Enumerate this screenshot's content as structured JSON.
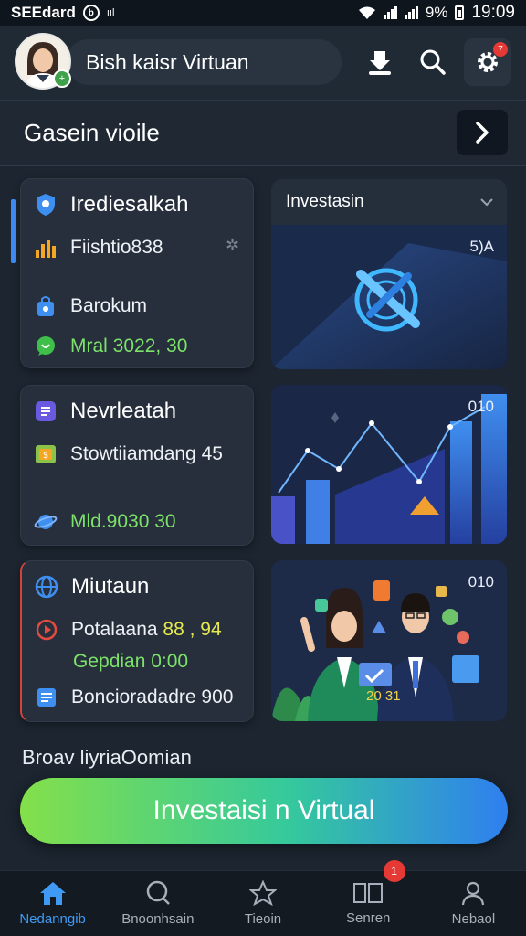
{
  "status_bar": {
    "left_text": "SEEdard",
    "circle_glyph": "b",
    "extra": "ııl",
    "battery_pct": "9%",
    "time": "19:09"
  },
  "header": {
    "user_name": "Bish kaisr Virtuan",
    "avatar_badge": "+",
    "settings_badge": "7"
  },
  "section": {
    "title": "Gasein vioile"
  },
  "cards": [
    {
      "title": "Irediesalkah",
      "rows": [
        {
          "text": "Fiishtio838"
        },
        {
          "text": "Barokum"
        },
        {
          "text": "Mral 3022, 30"
        }
      ]
    },
    {
      "title": "Nevrleatah",
      "rows": [
        {
          "text": "Stowtiiamdang 45"
        },
        {
          "text": "Mld.9030 30"
        }
      ]
    },
    {
      "title": "Miutaun",
      "rows": [
        {
          "text": "Potalaana ",
          "highlight": "88 , 94"
        },
        {
          "text": "Gepdian 0:00"
        },
        {
          "text": "Boncioradadre 900"
        }
      ]
    }
  ],
  "panels": [
    {
      "header": "Investasin",
      "label": "5)A"
    },
    {
      "label": "010"
    },
    {
      "label": "010",
      "caption": "20 31"
    }
  ],
  "footer_label": "Broav liyriaOomian",
  "cta_label": "Investaisi n Virtual",
  "bottom_nav": {
    "items": [
      {
        "label": "Nedanngib",
        "icon": "home-icon"
      },
      {
        "label": "Bnoonhsain",
        "icon": "search-icon"
      },
      {
        "label": "Tieoin",
        "icon": "star-icon"
      },
      {
        "label": "Senren",
        "icon": "columns-icon",
        "badge": "1"
      },
      {
        "label": "Nebaol",
        "icon": "user-icon"
      }
    ]
  },
  "colors": {
    "accent_blue": "#3f9af5",
    "green_value": "#7de26a",
    "yellow_value": "#e6e94f",
    "alert_red": "#e53935"
  }
}
